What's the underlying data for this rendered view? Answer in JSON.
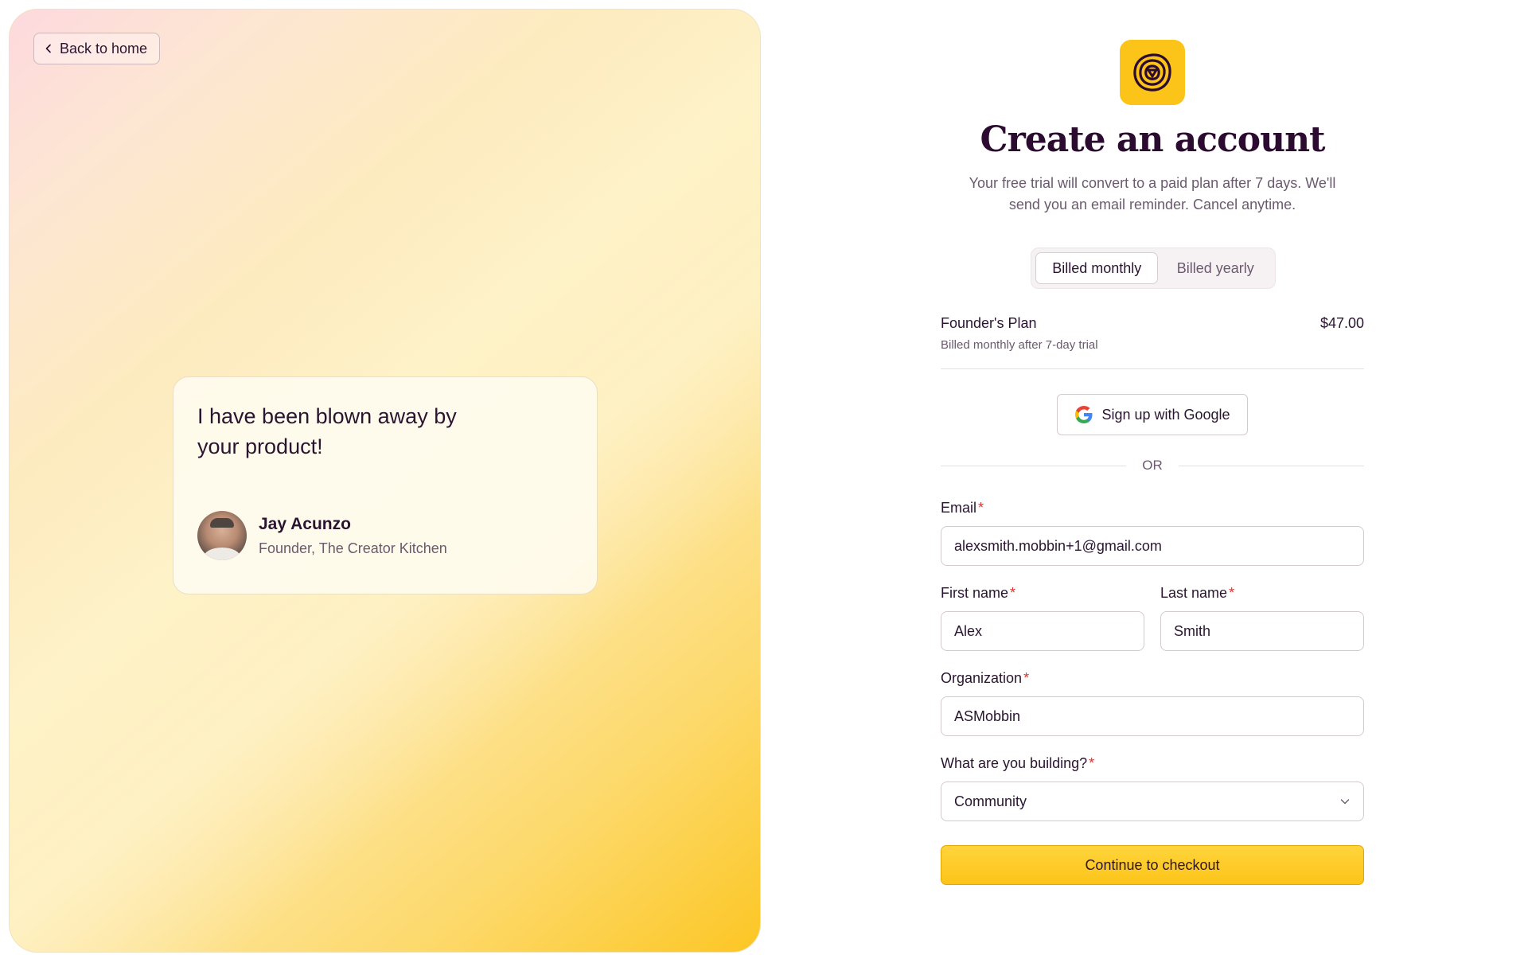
{
  "hero": {
    "back_label": "Back to home",
    "testimonial": {
      "quote": "I have been blown away by your product!",
      "author_name": "Jay Acunzo",
      "author_role": "Founder, The Creator Kitchen"
    }
  },
  "form": {
    "title": "Create an account",
    "subtitle": "Your free trial will convert to a paid plan after 7 days. We'll send you an email reminder. Cancel anytime.",
    "billing": {
      "monthly_label": "Billed monthly",
      "yearly_label": "Billed yearly",
      "selected": "monthly"
    },
    "plan": {
      "name": "Founder's Plan",
      "subtext": "Billed monthly after 7-day trial",
      "price": "$47.00"
    },
    "google_label": "Sign up with Google",
    "or_label": "OR",
    "required_mark": "*",
    "email": {
      "label": "Email",
      "value": "alexsmith.mobbin+1@gmail.com"
    },
    "first_name": {
      "label": "First name",
      "value": "Alex"
    },
    "last_name": {
      "label": "Last name",
      "value": "Smith"
    },
    "organization": {
      "label": "Organization",
      "value": "ASMobbin"
    },
    "building": {
      "label": "What are you building?",
      "value": "Community"
    },
    "submit_label": "Continue to checkout"
  },
  "colors": {
    "accent": "#fcc419",
    "heading": "#2b0b2f",
    "required": "#e03131"
  },
  "icons": [
    "chevron-left-icon",
    "app-logo-icon",
    "google-icon",
    "chevron-down-icon"
  ]
}
